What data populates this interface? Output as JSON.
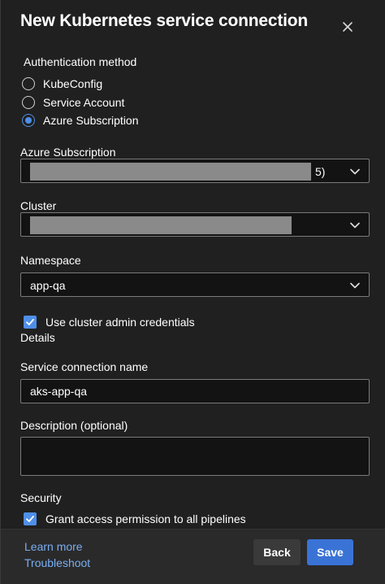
{
  "dialog": {
    "title": "New Kubernetes service connection"
  },
  "auth": {
    "label": "Authentication method",
    "options": [
      {
        "label": "KubeConfig",
        "checked": false
      },
      {
        "label": "Service Account",
        "checked": false
      },
      {
        "label": "Azure Subscription",
        "checked": true
      }
    ]
  },
  "subscription": {
    "label": "Azure Subscription",
    "value_suffix": "5)"
  },
  "cluster": {
    "label": "Cluster"
  },
  "namespace": {
    "label": "Namespace",
    "value": "app-qa"
  },
  "admin_credentials": {
    "label": "Use cluster admin credentials",
    "checked": true
  },
  "details": {
    "label": "Details"
  },
  "connection_name": {
    "label": "Service connection name",
    "value": "aks-app-qa"
  },
  "description": {
    "label": "Description (optional)",
    "value": ""
  },
  "security": {
    "label": "Security",
    "grant_access_label": "Grant access permission to all pipelines",
    "grant_access_checked": true
  },
  "footer": {
    "learn_more": "Learn more",
    "troubleshoot": "Troubleshoot",
    "back_label": "Back",
    "save_label": "Save"
  },
  "colors": {
    "accent": "#4f8fe8",
    "primary_button": "#3a73d6",
    "link": "#79aef2",
    "background": "#202020"
  },
  "icons": {
    "close": "close-icon",
    "dropdown": "chevron-down-icon",
    "check": "checkmark-icon"
  }
}
